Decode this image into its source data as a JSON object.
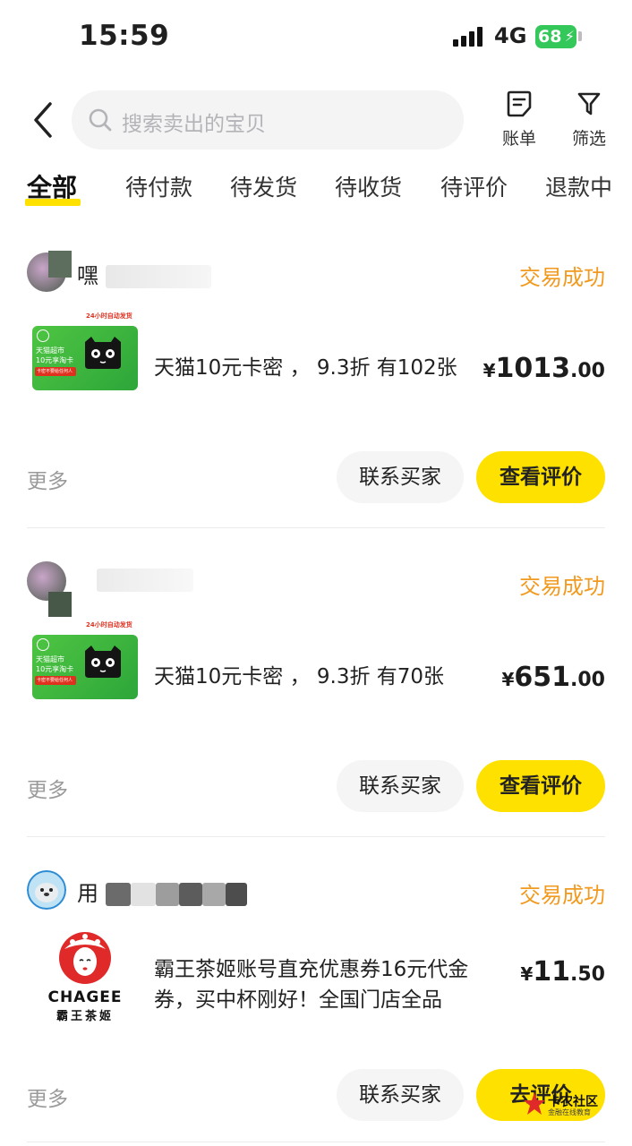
{
  "status_bar": {
    "time": "15:59",
    "network": "4G",
    "battery": "68"
  },
  "header": {
    "search_placeholder": "搜索卖出的宝贝",
    "bill_label": "账单",
    "filter_label": "筛选"
  },
  "tabs": [
    {
      "label": "全部",
      "active": true
    },
    {
      "label": "待付款"
    },
    {
      "label": "待发货"
    },
    {
      "label": "待收货"
    },
    {
      "label": "待评价"
    },
    {
      "label": "退款中"
    }
  ],
  "orders": [
    {
      "buyer_visible": "嘿",
      "status": "交易成功",
      "thumb_card": {
        "top": "24小时自动发货",
        "line1": "天猫超市",
        "line2": "10元享淘卡",
        "red": "卡密不要给任何人"
      },
      "title": "天猫10元卡密 ，  9.3折  有102张",
      "price": {
        "currency": "¥",
        "integer": "1013",
        "decimal": ".00"
      },
      "more_label": "更多",
      "contact_label": "联系买家",
      "action_label": "查看评价"
    },
    {
      "buyer_visible": "",
      "status": "交易成功",
      "thumb_card": {
        "top": "24小时自动发货",
        "line1": "天猫超市",
        "line2": "10元享淘卡",
        "red": "卡密不要给任何人"
      },
      "title": "天猫10元卡密 ，  9.3折  有70张",
      "price": {
        "currency": "¥",
        "integer": "651",
        "decimal": ".00"
      },
      "more_label": "更多",
      "contact_label": "联系买家",
      "action_label": "查看评价"
    },
    {
      "buyer_visible": "用",
      "status": "交易成功",
      "thumb_brand": {
        "en": "CHAGEE",
        "zh": "霸王茶姬"
      },
      "title": "霸王茶姬账号直充优惠券16元代金券，买中杯刚好！全国门店全品",
      "price": {
        "currency": "¥",
        "integer": "11",
        "decimal": ".50"
      },
      "more_label": "更多",
      "contact_label": "联系买家",
      "action_label": "去评价"
    }
  ],
  "watermark": {
    "line1": "卡农社区",
    "line2": "金融在线教育"
  },
  "colors": {
    "accent_yellow": "#ffe100",
    "status_orange": "#f29a1f",
    "battery_green": "#34c759"
  }
}
